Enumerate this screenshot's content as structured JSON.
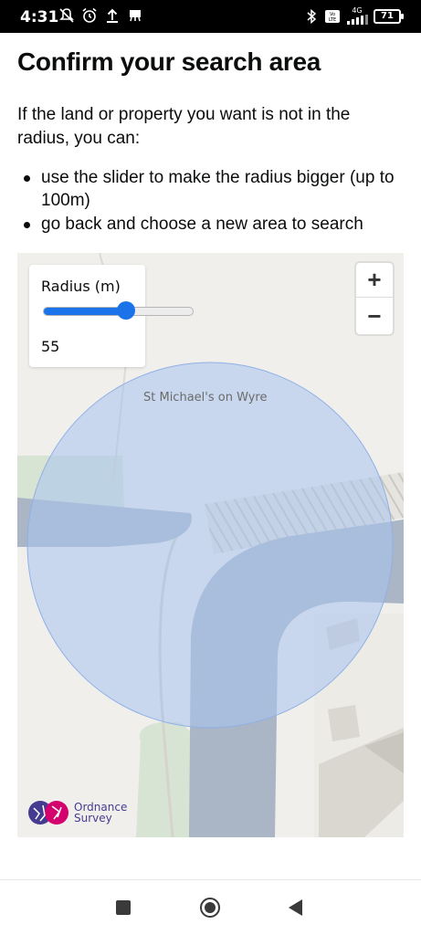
{
  "status_bar": {
    "time": "4:31",
    "left_icons": [
      "notifications-off-icon",
      "alarm-icon",
      "upload-icon",
      "cast-icon"
    ],
    "right_icons": [
      "bluetooth-icon",
      "volte-icon",
      "signal-4g-icon"
    ],
    "network_label": "4G",
    "battery": "71"
  },
  "page": {
    "title": "Confirm your search area",
    "intro": "If the land or property you want is not in the radius, you can:",
    "bullets": [
      "use the slider to make the radius bigger (up to 100m)",
      "go back and choose a new area to search"
    ]
  },
  "map": {
    "place_label": "St Michael's on Wyre",
    "radius_control": {
      "label": "Radius (m)",
      "value": "55",
      "min": 0,
      "max": 100,
      "accent_color": "#1a73e8"
    },
    "zoom_in": "+",
    "zoom_out": "−",
    "attribution": {
      "line1": "Ordnance",
      "line2": "Survey"
    },
    "colors": {
      "background": "#f0efec",
      "river": "#aab5c5",
      "woodland": "#d7e4d3",
      "buildings": "#dad6d0",
      "circle_fill": "#a7c3ef"
    }
  },
  "nav_bar": {
    "items": [
      "recent-apps-button",
      "home-button",
      "back-button"
    ]
  }
}
